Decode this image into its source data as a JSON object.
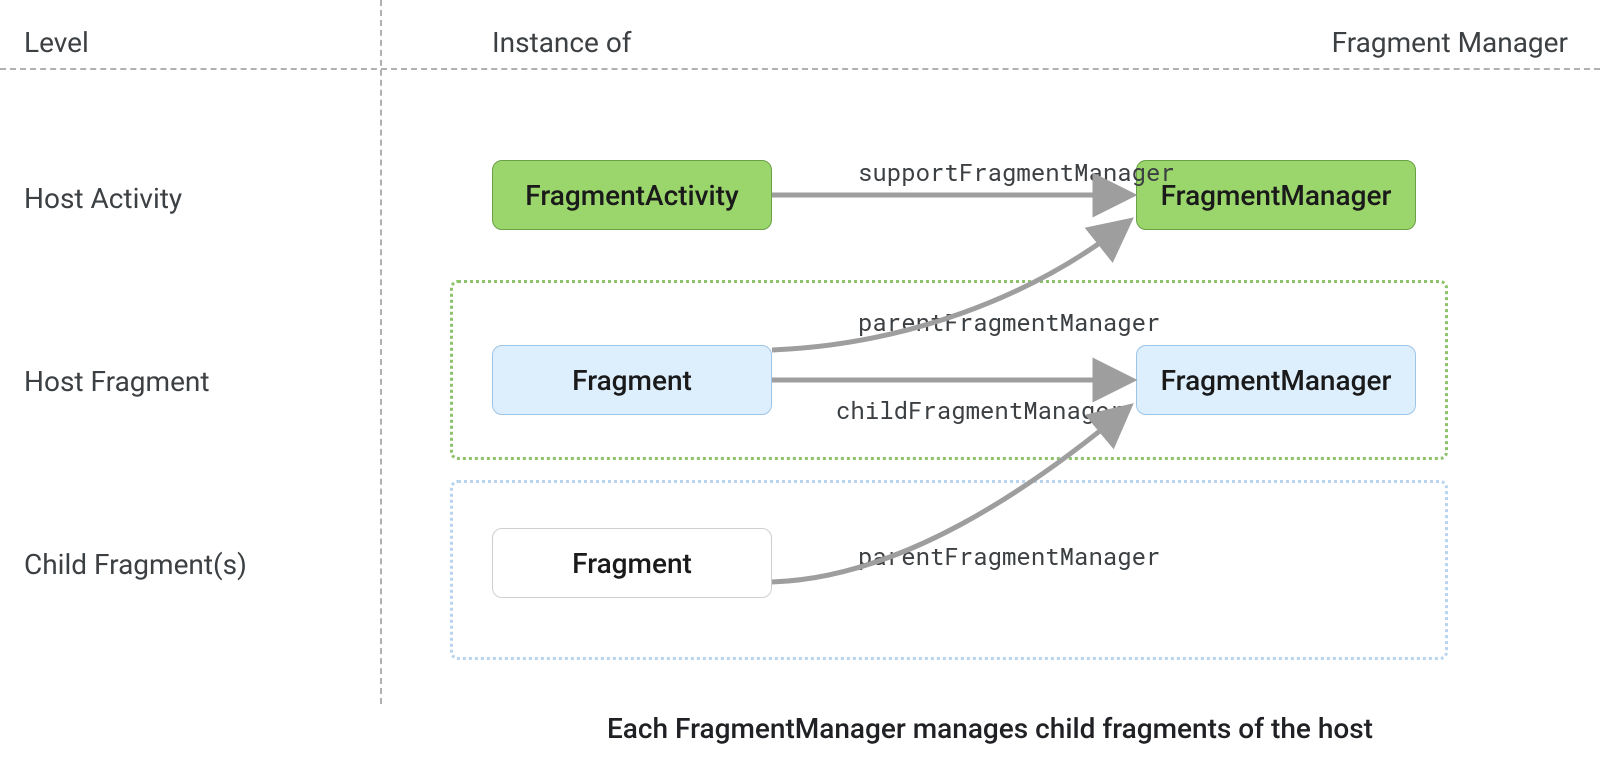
{
  "headers": {
    "level": "Level",
    "instance": "Instance of",
    "fragment_manager": "Fragment Manager"
  },
  "rows": {
    "host_activity": {
      "label": "Host Activity",
      "instance_box": "FragmentActivity",
      "manager_box": "FragmentManager"
    },
    "host_fragment": {
      "label": "Host Fragment",
      "instance_box": "Fragment",
      "manager_box": "FragmentManager"
    },
    "child_fragment": {
      "label": "Child Fragment(s)",
      "instance_box": "Fragment"
    }
  },
  "arrows": {
    "support": "supportFragmentManager",
    "parent_from_host_fragment": "parentFragmentManager",
    "child": "childFragmentManager",
    "parent_from_child_fragment": "parentFragmentManager"
  },
  "caption": "Each FragmentManager manages child fragments of the host",
  "colors": {
    "green_fill": "#9ad66b",
    "blue_fill": "#ddeefc",
    "arrow": "#9e9e9e"
  }
}
